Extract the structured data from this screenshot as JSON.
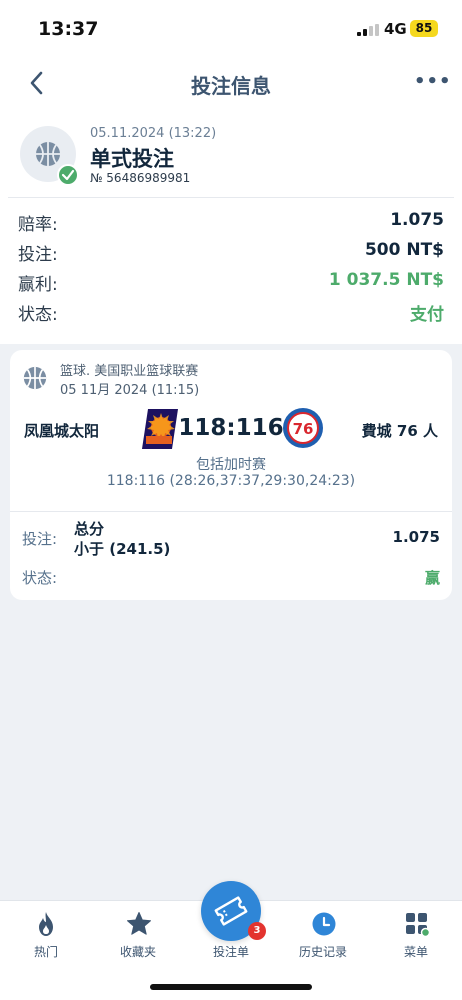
{
  "status_bar": {
    "time": "13:37",
    "network": "4G",
    "battery": "85"
  },
  "header": {
    "title": "投注信息",
    "more": "•••"
  },
  "bet": {
    "date": "05.11.2024 (13:22)",
    "type": "单式投注",
    "number": "№ 56486989981",
    "rows": [
      {
        "label": "赔率:",
        "value": "1.075"
      },
      {
        "label": "投注:",
        "value": "500 NT$"
      },
      {
        "label": "赢利:",
        "value": "1 037.5 NT$"
      },
      {
        "label": "状态:",
        "value": "支付"
      }
    ]
  },
  "event": {
    "league": "篮球. 美国职业篮球联赛",
    "time": "05 11月 2024 (11:15)",
    "home_team": "凤凰城太阳",
    "away_team": "費城 76 人",
    "score": "118:116",
    "overtime_note": "包括加时赛",
    "periods": "118:116 (28:26,37:37,29:30,24:23)",
    "stake_label": "投注:",
    "market": "总分",
    "pick": "小于 (241.5)",
    "odds": "1.075",
    "state_label": "状态:",
    "state": "赢"
  },
  "nav": {
    "items": [
      {
        "label": "热门"
      },
      {
        "label": "收藏夹"
      },
      {
        "label": "投注单"
      },
      {
        "label": "历史记录"
      },
      {
        "label": "菜单"
      }
    ],
    "betslip_count": "3"
  },
  "colors": {
    "accent": "#2f86d7",
    "win": "#4dab6b",
    "text": "#12273c",
    "muted": "#56718c"
  }
}
